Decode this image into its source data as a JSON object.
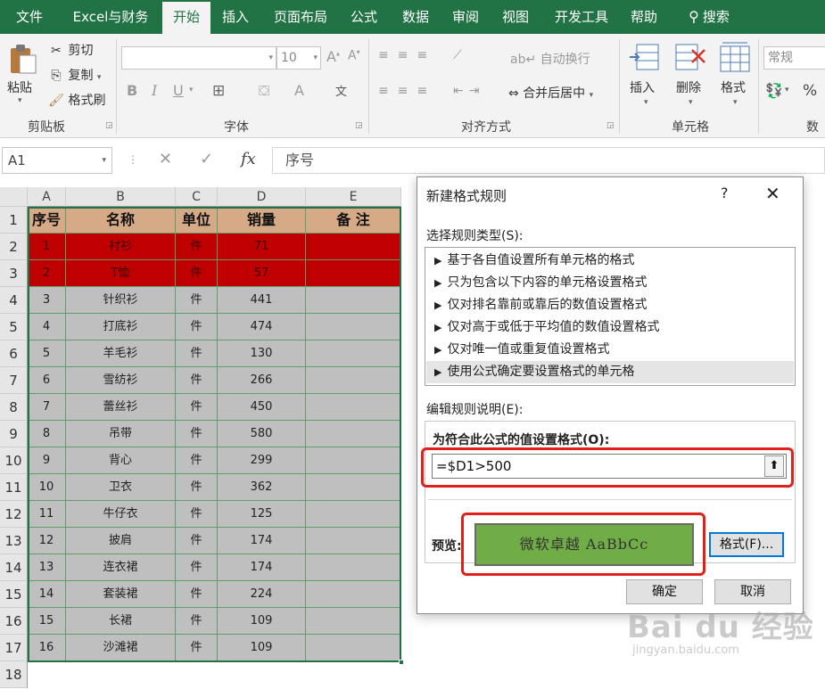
{
  "tabs": [
    {
      "label": "文件",
      "active": false
    },
    {
      "label": "Excel与财务",
      "active": false
    },
    {
      "label": "开始",
      "active": true
    },
    {
      "label": "插入",
      "active": false
    },
    {
      "label": "页面布局",
      "active": false
    },
    {
      "label": "公式",
      "active": false
    },
    {
      "label": "数据",
      "active": false
    },
    {
      "label": "审阅",
      "active": false
    },
    {
      "label": "视图",
      "active": false
    },
    {
      "label": "开发工具",
      "active": false
    },
    {
      "label": "帮助",
      "active": false
    },
    {
      "label": "搜索",
      "active": false
    }
  ],
  "ribbon": {
    "clipboard": {
      "paste": "粘贴",
      "cut": "剪切",
      "copy": "复制",
      "format_painter": "格式刷",
      "group": "剪贴板"
    },
    "font": {
      "font_name": "",
      "font_size": "10",
      "group": "字体",
      "bold": "B",
      "italic": "I",
      "underline": "U",
      "font_color_glyph": "A",
      "phonetic_glyph": "文"
    },
    "alignment": {
      "wrap": "自动换行",
      "merge": "合并后居中",
      "group": "对齐方式"
    },
    "cells": {
      "insert": "插入",
      "delete": "删除",
      "format": "格式",
      "group": "单元格"
    },
    "number": {
      "format": "常规",
      "group": "数",
      "percent": "%"
    }
  },
  "formula_bar": {
    "name_box": "A1",
    "formula": "序号"
  },
  "columns": [
    {
      "letter": "A"
    },
    {
      "letter": "B"
    },
    {
      "letter": "C"
    },
    {
      "letter": "D"
    },
    {
      "letter": "E"
    }
  ],
  "table": {
    "headers": [
      "序号",
      "名称",
      "单位",
      "销量",
      "备  注"
    ],
    "rows": [
      [
        "1",
        "衬衫",
        "件",
        "71",
        ""
      ],
      [
        "2",
        "T恤",
        "件",
        "57",
        ""
      ],
      [
        "3",
        "针织衫",
        "件",
        "441",
        ""
      ],
      [
        "4",
        "打底衫",
        "件",
        "474",
        ""
      ],
      [
        "5",
        "羊毛衫",
        "件",
        "130",
        ""
      ],
      [
        "6",
        "雪纺衫",
        "件",
        "266",
        ""
      ],
      [
        "7",
        "蕾丝衫",
        "件",
        "450",
        ""
      ],
      [
        "8",
        "吊带",
        "件",
        "580",
        ""
      ],
      [
        "9",
        "背心",
        "件",
        "299",
        ""
      ],
      [
        "10",
        "卫衣",
        "件",
        "362",
        ""
      ],
      [
        "11",
        "牛仔衣",
        "件",
        "125",
        ""
      ],
      [
        "12",
        "披肩",
        "件",
        "174",
        ""
      ],
      [
        "13",
        "连衣裙",
        "件",
        "174",
        ""
      ],
      [
        "14",
        "套装裙",
        "件",
        "224",
        ""
      ],
      [
        "15",
        "长裙",
        "件",
        "109",
        ""
      ],
      [
        "16",
        "沙滩裙",
        "件",
        "109",
        ""
      ]
    ],
    "highlighted_rows": [
      1,
      2
    ]
  },
  "row_numbers": [
    "1",
    "2",
    "3",
    "4",
    "5",
    "6",
    "7",
    "8",
    "9",
    "10",
    "11",
    "12",
    "13",
    "14",
    "15",
    "16",
    "17",
    "18"
  ],
  "dialog": {
    "title": "新建格式规则",
    "help": "?",
    "close": "✕",
    "rule_type_label": "选择规则类型(S):",
    "rule_types": [
      "基于各自值设置所有单元格的格式",
      "只为包含以下内容的单元格设置格式",
      "仅对排名靠前或靠后的数值设置格式",
      "仅对高于或低于平均值的数值设置格式",
      "仅对唯一值或重复值设置格式",
      "使用公式确定要设置格式的单元格"
    ],
    "selected_rule_index": 5,
    "edit_label": "编辑规则说明(E):",
    "formula_label": "为符合此公式的值设置格式(O):",
    "formula_value": "=$D1>500",
    "preview_label": "预览:",
    "preview_text": "微软卓越    AaBbCc",
    "format_button": "格式(F)...",
    "ok_button": "确定",
    "cancel_button": "取消"
  },
  "colors": {
    "excel_green": "#217346",
    "header_fill": "#d6aa86",
    "highlight_red": "#c00000",
    "data_gray": "#bfbfbf",
    "preview_green": "#70ad47",
    "annotation_red": "#e0211b"
  },
  "icons": [
    "search-icon",
    "paste-icon",
    "cut-icon",
    "copy-icon",
    "format-painter-icon",
    "cancel-icon",
    "enter-icon",
    "function-icon",
    "collapse-dialog-icon"
  ],
  "watermark": {
    "main": "Bai du 经验",
    "sub": "jingyan.baidu.com"
  }
}
